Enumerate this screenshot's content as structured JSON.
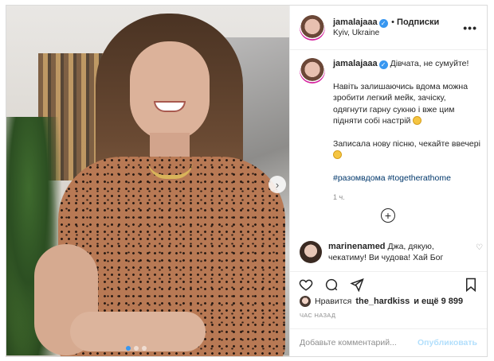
{
  "post": {
    "username": "jamalajaaa",
    "follow_label": "Подписки",
    "location": "Kyiv, Ukraine",
    "more_label": "•••",
    "caption": {
      "line1": "Дівчата, не сумуйте!",
      "para2": "Навіть залишаючись вдома можна зробити легкий мейк, зачіску, одягнути гарну сукню і вже цим підняти собі настрій",
      "para3": "Записала нову пісню, чекайте ввечері",
      "hashtags": "#разомвдома #togetherathome",
      "time": "1 ч."
    },
    "comment": {
      "username": "marinenamed",
      "text": "Джа, дякую, чекатиму! Ви чудова! Хай Бог"
    },
    "likes": {
      "prefix": "Нравится",
      "liked_by": "the_hardkiss",
      "suffix": "и ещё 9 899"
    },
    "ago": "ЧАС НАЗАД",
    "add_comment": {
      "placeholder": "Добавьте комментарий...",
      "publish_label": "Опубликовать"
    }
  },
  "colors": {
    "link": "#00376b",
    "verified": "#3897f0",
    "publish_disabled": "#b2dffc",
    "meta": "#8e8e8e"
  },
  "icons": [
    "verified-badge-icon",
    "more-options-icon",
    "next-arrow-icon",
    "add-icon",
    "heart-icon",
    "comment-icon",
    "share-icon",
    "bookmark-icon"
  ]
}
